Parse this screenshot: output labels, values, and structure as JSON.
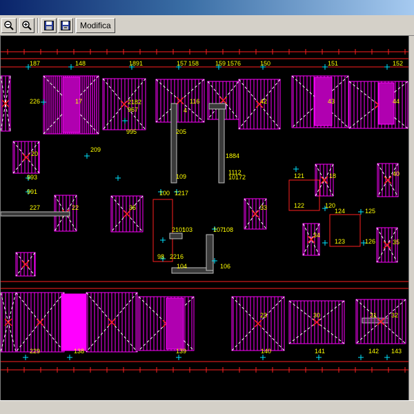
{
  "toolbar": {
    "zoom_out_icon": "magnifier-icon",
    "zoom_in_icon": "magnifier-plus-icon",
    "save_icon": "floppy-disk-icon",
    "save_as_icon": "floppy-disk-icon",
    "modifica_label": "Modifica"
  },
  "drawing": {
    "colors": {
      "wall": "#ff00ff",
      "dim": "#ff2020",
      "label": "#ffff00",
      "cross": "#00e5ff",
      "diag": "#ffffff"
    },
    "top_labels": [
      "187",
      "148",
      "1891",
      "157",
      "158",
      "159",
      "1576",
      "150",
      "151",
      "152"
    ],
    "bottom_labels": [
      "229",
      "138",
      "139",
      "140",
      "141",
      "142",
      "143"
    ],
    "node_labels": [
      "226",
      "2182",
      "967",
      "995",
      "116",
      "209",
      "205",
      "1884",
      "1112",
      "10172",
      "109",
      "993",
      "991",
      "227",
      "100",
      "1217",
      "121",
      "122",
      "120",
      "124",
      "125",
      "123",
      "126",
      "2101",
      "103",
      "107",
      "108",
      "98",
      "2216",
      "104",
      "106",
      "40"
    ],
    "room_labels": [
      "20",
      "22",
      "36",
      "33",
      "34",
      "35",
      "43",
      "44",
      "42",
      "32",
      "30",
      "31",
      "23",
      "18",
      "17",
      "4"
    ]
  }
}
